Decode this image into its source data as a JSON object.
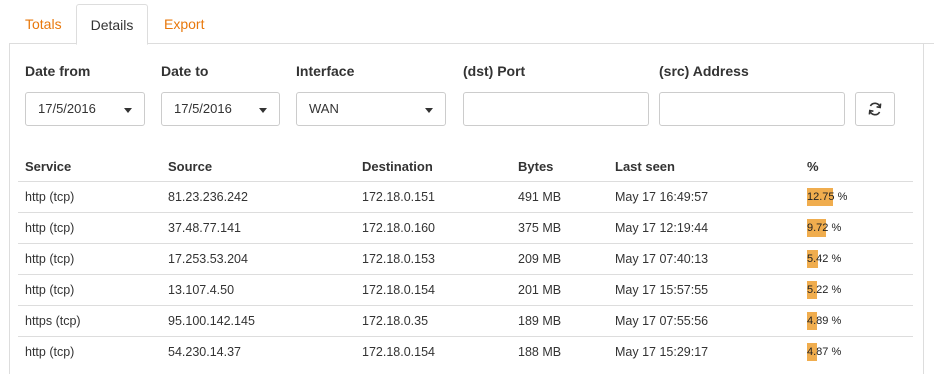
{
  "tabs": [
    {
      "label": "Totals",
      "active": false
    },
    {
      "label": "Details",
      "active": true
    },
    {
      "label": "Export",
      "active": false
    }
  ],
  "filters": {
    "date_from": {
      "label": "Date from",
      "value": "17/5/2016"
    },
    "date_to": {
      "label": "Date to",
      "value": "17/5/2016"
    },
    "interface": {
      "label": "Interface",
      "value": "WAN"
    },
    "dst_port": {
      "label": "(dst) Port",
      "value": ""
    },
    "src_address": {
      "label": "(src) Address",
      "value": ""
    },
    "refresh_icon": "refresh-icon"
  },
  "table": {
    "headers": [
      "Service",
      "Source",
      "Destination",
      "Bytes",
      "Last seen",
      "%"
    ],
    "rows": [
      {
        "service": "http (tcp)",
        "source": "81.23.236.242",
        "destination": "172.18.0.151",
        "bytes": "491 MB",
        "last_seen": "May 17 16:49:57",
        "percent": "12.75",
        "pct_suffix": "%",
        "percent_value": 12.75
      },
      {
        "service": "http (tcp)",
        "source": "37.48.77.141",
        "destination": "172.18.0.160",
        "bytes": "375 MB",
        "last_seen": "May 17 12:19:44",
        "percent": "9.72",
        "pct_suffix": "%",
        "percent_value": 9.72
      },
      {
        "service": "http (tcp)",
        "source": "17.253.53.204",
        "destination": "172.18.0.153",
        "bytes": "209 MB",
        "last_seen": "May 17 07:40:13",
        "percent": "5.42",
        "pct_suffix": "%",
        "percent_value": 5.42
      },
      {
        "service": "http (tcp)",
        "source": "13.107.4.50",
        "destination": "172.18.0.154",
        "bytes": "201 MB",
        "last_seen": "May 17 15:57:55",
        "percent": "5.22",
        "pct_suffix": "%",
        "percent_value": 5.22
      },
      {
        "service": "https (tcp)",
        "source": "95.100.142.145",
        "destination": "172.18.0.35",
        "bytes": "189 MB",
        "last_seen": "May 17 07:55:56",
        "percent": "4.89",
        "pct_suffix": "%",
        "percent_value": 4.89
      },
      {
        "service": "http (tcp)",
        "source": "54.230.14.37",
        "destination": "172.18.0.154",
        "bytes": "188 MB",
        "last_seen": "May 17 15:29:17",
        "percent": "4.87",
        "pct_suffix": "%",
        "percent_value": 4.87
      }
    ]
  },
  "colors": {
    "accent": "#e8780c",
    "bar": "#f0ad4e",
    "border": "#dddddd"
  }
}
